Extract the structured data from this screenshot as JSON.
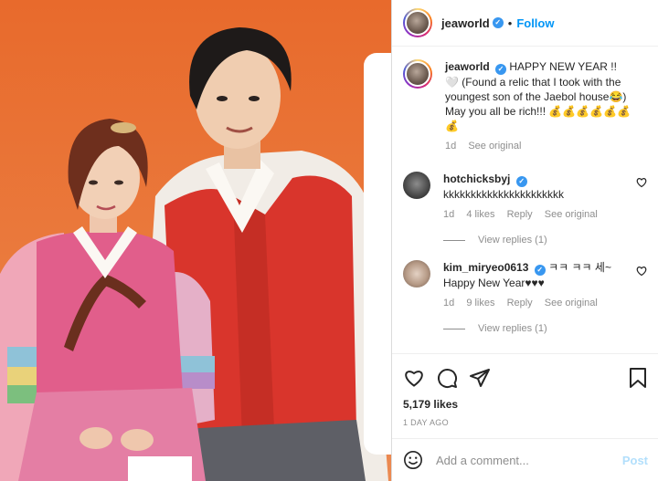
{
  "post": {
    "username": "jeaworld",
    "follow_label": "Follow",
    "dot": "•",
    "more": "···"
  },
  "caption": {
    "username": "jeaworld",
    "text": "HAPPY NEW YEAR !! 🤍 (Found a relic that I took with the youngest son of the Jaebol house😂) May you all be rich!!! 💰💰💰💰💰💰💰",
    "time": "1d",
    "see_original": "See original"
  },
  "comments": [
    {
      "username": "hotchicksbyj",
      "text": "kkkkkkkkkkkkkkkkkkkkkk",
      "time": "1d",
      "likes": "4 likes",
      "reply": "Reply",
      "see_original": "See original",
      "view_replies": "View replies (1)"
    },
    {
      "username": "kim_miryeo0613",
      "text": "ㅋㅋ ㅋㅋ 세~ Happy New Year♥♥♥",
      "time": "1d",
      "likes": "9 likes",
      "reply": "Reply",
      "see_original": "See original",
      "view_replies": "View replies (1)"
    }
  ],
  "stats": {
    "likes": "5,179 likes",
    "age": "1 DAY AGO"
  },
  "add_comment": {
    "placeholder": "Add a comment...",
    "post_label": "Post"
  },
  "icons": [
    "heart-icon",
    "comment-icon",
    "share-icon",
    "bookmark-icon",
    "emoji-icon",
    "verified-icon",
    "more-icon"
  ],
  "colors": {
    "accent": "#0095f6",
    "verified": "#3897f0",
    "photo_bg": "#e86a2c"
  }
}
